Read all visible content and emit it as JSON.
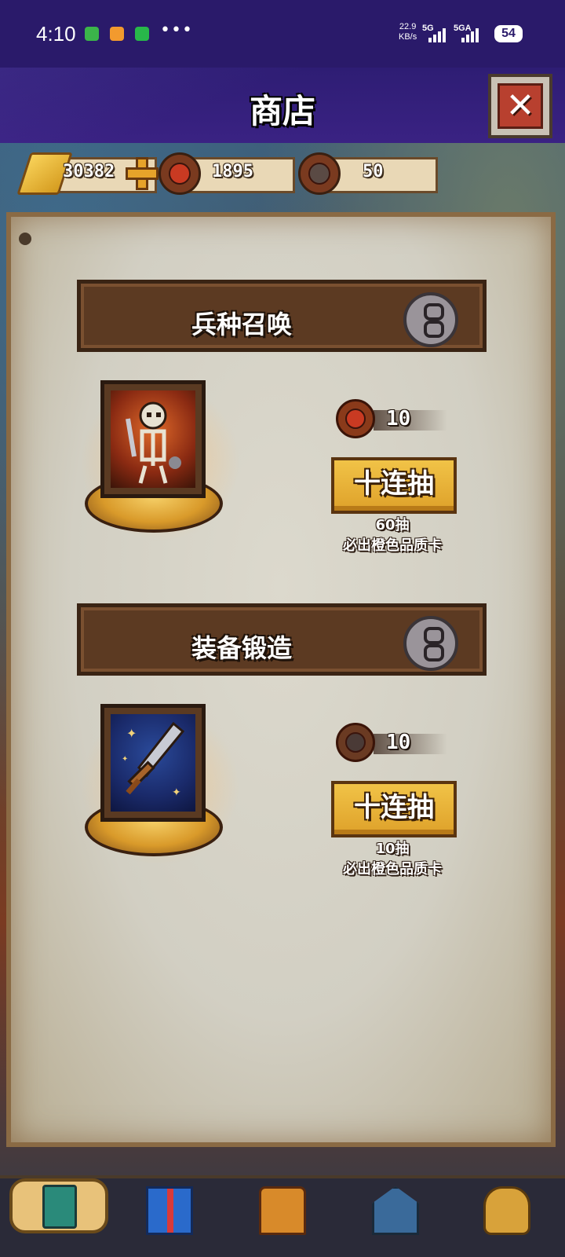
{
  "status_bar": {
    "time": "4:10",
    "speed_value": "22.9",
    "speed_unit": "KB/s",
    "net1": "5G",
    "net2": "5GA",
    "battery": "54"
  },
  "header": {
    "title": "商店",
    "close_icon": "close-icon"
  },
  "currencies": [
    {
      "name": "gold-bar-icon",
      "value": "30382"
    },
    {
      "name": "demon-token-icon",
      "value": "1895"
    },
    {
      "name": "anvil-token-icon",
      "value": "50"
    }
  ],
  "sections": [
    {
      "title": "兵种召唤",
      "art": "skeleton-card-icon",
      "cost_icon": "demon-token-icon",
      "cost": "10",
      "button": "十连抽",
      "note_line1": "60抽",
      "note_line2": "必出橙色品质卡"
    },
    {
      "title": "装备锻造",
      "art": "sword-card-icon",
      "cost_icon": "anvil-token-icon",
      "cost": "10",
      "button": "十连抽",
      "note_line1": "10抽",
      "note_line2": "必出橙色品质卡"
    }
  ],
  "bottom_nav": [
    {
      "icon": "card-deck-icon",
      "active": true
    },
    {
      "icon": "gift-box-icon",
      "active": false
    },
    {
      "icon": "treasure-chest-icon",
      "active": false
    },
    {
      "icon": "barracks-house-icon",
      "active": false
    },
    {
      "icon": "vip-bag-icon",
      "active": false
    }
  ],
  "colors": {
    "header_bg": "#2e1d74",
    "parchment": "#d2cfc3",
    "banner": "#5c3a22",
    "button_gold": "#f1c347"
  }
}
